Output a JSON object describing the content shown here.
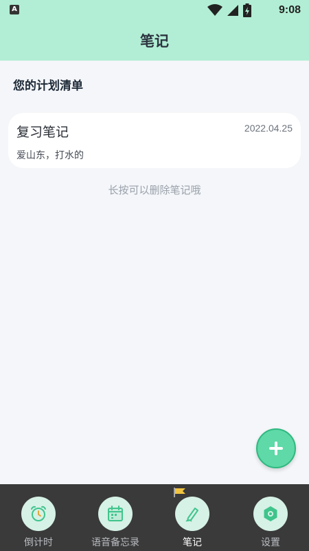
{
  "status_bar": {
    "app_icon_letter": "A",
    "time": "9:08",
    "icons": [
      "wifi-icon",
      "signal-icon",
      "battery-icon"
    ]
  },
  "header": {
    "title": "笔记"
  },
  "section": {
    "title": "您的计划清单"
  },
  "notes": [
    {
      "title": "复习笔记",
      "date": "2022.04.25",
      "content": "爱山东，打水的"
    }
  ],
  "hint": "长按可以删除笔记哦",
  "fab": {
    "icon": "plus-icon"
  },
  "bottom_nav": {
    "items": [
      {
        "label": "倒计时",
        "icon": "alarm-clock-icon",
        "active": false
      },
      {
        "label": "语音备忘录",
        "icon": "calendar-icon",
        "active": false
      },
      {
        "label": "笔记",
        "icon": "pen-icon",
        "active": true
      },
      {
        "label": "设置",
        "icon": "settings-icon",
        "active": false
      }
    ]
  },
  "colors": {
    "header_bg": "#b2eed5",
    "page_bg": "#f4f6f9",
    "accent": "#5ed9a7",
    "nav_bg": "#3a3a3a",
    "nav_circle": "#d6f1e6"
  }
}
